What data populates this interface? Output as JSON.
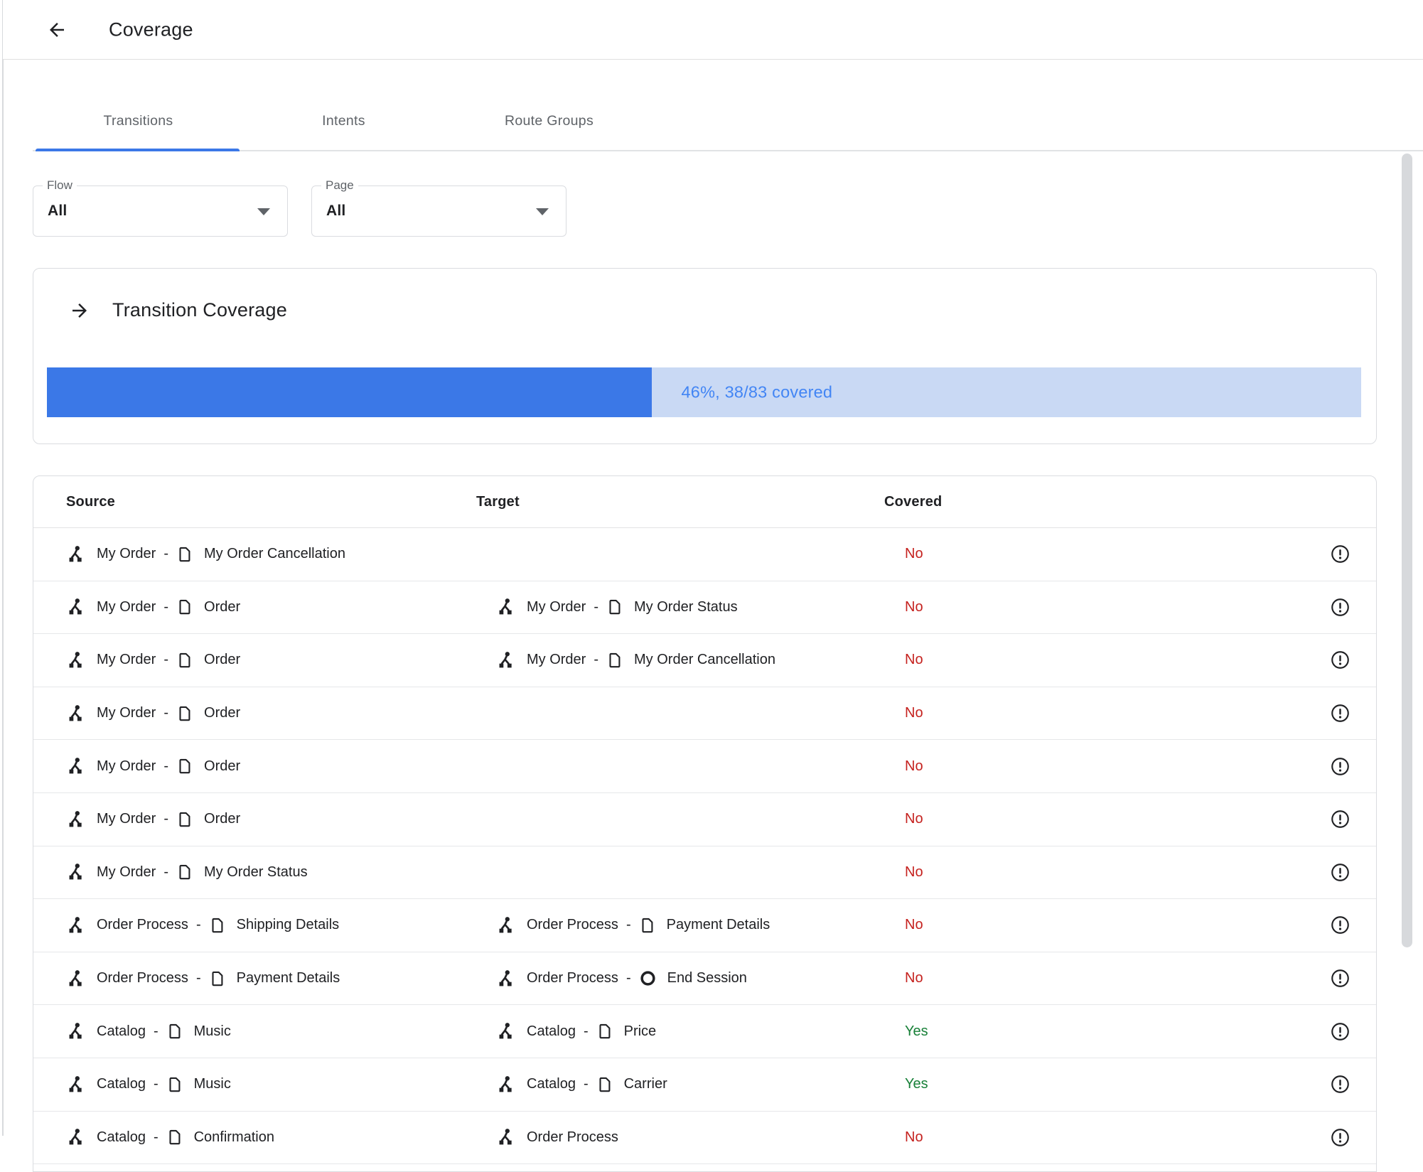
{
  "header": {
    "title": "Coverage"
  },
  "tabs": [
    {
      "label": "Transitions",
      "active": true
    },
    {
      "label": "Intents",
      "active": false
    },
    {
      "label": "Route Groups",
      "active": false
    }
  ],
  "filters": [
    {
      "label": "Flow",
      "value": "All"
    },
    {
      "label": "Page",
      "value": "All"
    }
  ],
  "coverage_card": {
    "title": "Transition Coverage",
    "percent": 46,
    "covered_count": 38,
    "total_count": 83,
    "progress_label": "46%, 38/83 covered"
  },
  "table": {
    "columns": [
      "Source",
      "Target",
      "Covered"
    ],
    "separator": "-",
    "covered_yes": "Yes",
    "covered_no": "No",
    "rows": [
      {
        "source": {
          "flow": "My Order",
          "page": "My Order Cancellation",
          "page_icon": "page"
        },
        "target": null,
        "covered": "No"
      },
      {
        "source": {
          "flow": "My Order",
          "page": "Order",
          "page_icon": "page"
        },
        "target": {
          "flow": "My Order",
          "page": "My Order Status",
          "page_icon": "page"
        },
        "covered": "No"
      },
      {
        "source": {
          "flow": "My Order",
          "page": "Order",
          "page_icon": "page"
        },
        "target": {
          "flow": "My Order",
          "page": "My Order Cancellation",
          "page_icon": "page"
        },
        "covered": "No"
      },
      {
        "source": {
          "flow": "My Order",
          "page": "Order",
          "page_icon": "page"
        },
        "target": null,
        "covered": "No"
      },
      {
        "source": {
          "flow": "My Order",
          "page": "Order",
          "page_icon": "page"
        },
        "target": null,
        "covered": "No"
      },
      {
        "source": {
          "flow": "My Order",
          "page": "Order",
          "page_icon": "page"
        },
        "target": null,
        "covered": "No"
      },
      {
        "source": {
          "flow": "My Order",
          "page": "My Order Status",
          "page_icon": "page"
        },
        "target": null,
        "covered": "No"
      },
      {
        "source": {
          "flow": "Order Process",
          "page": "Shipping Details",
          "page_icon": "page"
        },
        "target": {
          "flow": "Order Process",
          "page": "Payment Details",
          "page_icon": "page"
        },
        "covered": "No"
      },
      {
        "source": {
          "flow": "Order Process",
          "page": "Payment Details",
          "page_icon": "page"
        },
        "target": {
          "flow": "Order Process",
          "page": "End Session",
          "page_icon": "end-session"
        },
        "covered": "No"
      },
      {
        "source": {
          "flow": "Catalog",
          "page": "Music",
          "page_icon": "page"
        },
        "target": {
          "flow": "Catalog",
          "page": "Price",
          "page_icon": "page"
        },
        "covered": "Yes"
      },
      {
        "source": {
          "flow": "Catalog",
          "page": "Music",
          "page_icon": "page"
        },
        "target": {
          "flow": "Catalog",
          "page": "Carrier",
          "page_icon": "page"
        },
        "covered": "Yes"
      },
      {
        "source": {
          "flow": "Catalog",
          "page": "Confirmation",
          "page_icon": "page"
        },
        "target": {
          "flow": "Order Process",
          "page": null,
          "page_icon": null
        },
        "covered": "No"
      }
    ]
  },
  "icons": [
    "back-arrow-icon",
    "forward-arrow-icon",
    "dropdown-arrow-icon",
    "flow-icon",
    "page-icon",
    "end-session-icon",
    "error-outline-icon"
  ],
  "colors": {
    "accent_blue": "#3b78e7",
    "progress_track": "#c9d9f4",
    "progress_text": "#4285f4",
    "covered_yes_green": "#188038",
    "covered_no_red": "#c5221f",
    "text_primary": "#202124",
    "text_secondary": "#5f6368",
    "border": "#dadce0"
  }
}
